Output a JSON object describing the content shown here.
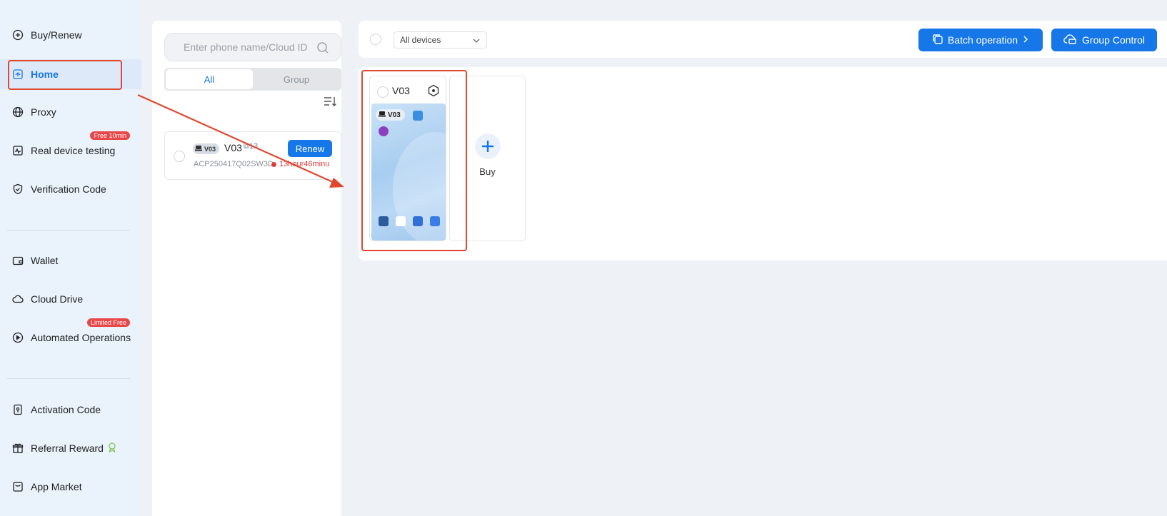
{
  "sidebar": {
    "items": [
      {
        "label": "Buy/Renew",
        "icon": "plus-circle-icon"
      },
      {
        "label": "Home",
        "icon": "home-icon"
      },
      {
        "label": "Proxy",
        "icon": "globe-icon"
      },
      {
        "label": "Real device testing",
        "icon": "pulse-icon",
        "badge": "Free 10min"
      },
      {
        "label": "Verification Code",
        "icon": "shield-check-icon"
      },
      {
        "label": "Wallet",
        "icon": "wallet-icon"
      },
      {
        "label": "Cloud Drive",
        "icon": "cloud-icon"
      },
      {
        "label": "Automated Operations",
        "icon": "play-circle-icon",
        "badge": "Limited Free"
      },
      {
        "label": "Activation Code",
        "icon": "key-card-icon"
      },
      {
        "label": "Referral Reward",
        "icon": "gift-icon"
      },
      {
        "label": "App Market",
        "icon": "store-icon"
      }
    ]
  },
  "device_list": {
    "search_placeholder": "Enter phone name/Cloud ID",
    "tabs": [
      "All",
      "Group"
    ],
    "active_tab": "All",
    "devices": [
      {
        "tag": "V03",
        "name": "V03",
        "extra": "13",
        "cloud_id": "ACP250417Q02SW3D",
        "time_left": "13hour46minu",
        "action": "Renew"
      }
    ]
  },
  "toolbar": {
    "filter_value": "All devices",
    "batch_label": "Batch operation",
    "group_label": "Group Control"
  },
  "grid": {
    "phones": [
      {
        "name": "V03",
        "tag": "V03"
      }
    ],
    "buy_label": "Buy"
  },
  "colors": {
    "accent": "#1677e8",
    "annotation": "#e0472f",
    "badge": "#e8474a",
    "sidebar_bg": "#eaf2fb"
  }
}
